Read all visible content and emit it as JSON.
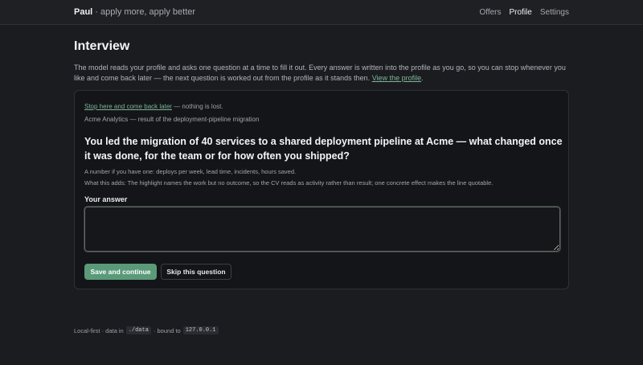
{
  "header": {
    "brand_name": "Paul",
    "brand_tagline": "· apply more, apply better",
    "nav": [
      {
        "label": "Offers"
      },
      {
        "label": "Profile"
      },
      {
        "label": "Settings"
      }
    ]
  },
  "page": {
    "title": "Interview",
    "intro": "The model reads your profile and asks one question at a time to fill it out. Every answer is written into the profile as you go, so you can stop whenever you like and come back later — the next question is worked out from the profile as it stands then.",
    "intro_link": "View the profile",
    "intro_end": "."
  },
  "card": {
    "stop_link": "Stop here and come back later",
    "stop_suffix": " — nothing is lost.",
    "context": "Acme Analytics — result of the deployment-pipeline migration",
    "question": "You led the migration of 40 services to a shared deployment pipeline at Acme — what changed once it was done, for the team or for how often you shipped?",
    "hint": "A number if you have one: deploys per week, lead time, incidents, hours saved.",
    "adds": "What this adds: The highlight names the work but no outcome, so the CV reads as activity rather than result; one concrete effect makes the line quotable.",
    "answer_label": "Your answer",
    "answer_value": "",
    "save_label": "Save and continue",
    "skip_label": "Skip this question"
  },
  "footer": {
    "prefix": "Local-first · data in",
    "data_dir": "./data",
    "middle": "· bound to",
    "address": "127.0.0.1"
  }
}
